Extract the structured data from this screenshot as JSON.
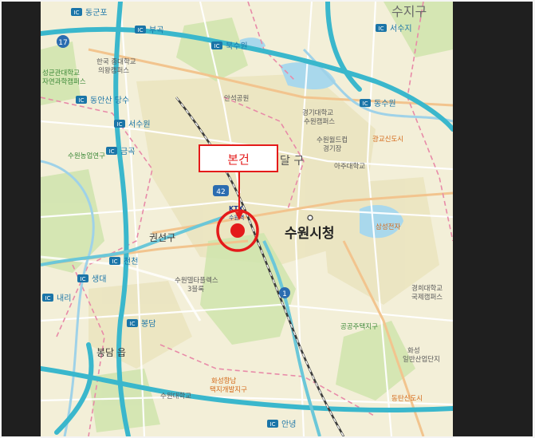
{
  "map": {
    "districts": {
      "suji": "수지구",
      "gwonseon": "권선구",
      "paldal": "달 구",
      "bongdam": "봉담 읍"
    },
    "city_hall": "수원시청",
    "callout": {
      "label": "본건"
    },
    "ic_badge": "IC",
    "interchanges": {
      "dongsuwon_top": "동군포",
      "bugok": "부곡",
      "buksuwon": "북수원",
      "seosuji": "서수지",
      "dongsuwon": "동수원",
      "dongansan": "동안산 당수",
      "seosuwon": "서수원",
      "geumgok": "금곡",
      "cheoncheon": "천천",
      "saengdae": "생대",
      "naeri": "내리",
      "bongdam": "봉담",
      "anyeong": "안녕"
    },
    "route_numbers": {
      "r17": "17",
      "r42": "42",
      "r1": "1",
      "r43": "43"
    },
    "places": {
      "hanguk": "한국 종대학교",
      "uiwang": "의왕캠퍼스",
      "seonggyun": "성균관대학교",
      "seonggyun2": "자연과학캠퍼스",
      "anseok": "안석공원",
      "gyeonggi": "경기대학교",
      "gyeonggi2": "수원캠퍼스",
      "suwon_world": "수원월드컵",
      "stadium": "경기장",
      "ajou": "아주대학교",
      "suwonsi_nonghyup": "수원농업연구",
      "gwanggyo": "광교신도시",
      "samsung": "삼성전자",
      "korail": "KTX",
      "suwon_station": "수원역",
      "suwon_datapark": "수원델타플렉스",
      "block3": "3블록",
      "suwon_univ": "수원대학교",
      "hwaseong": "화성향남",
      "hwaseong2": "택지개발지구",
      "gyunghee": "경희대학교",
      "gyunghee2": "국제캠퍼스",
      "dongtan": "동탄신도시",
      "hwaseong_ind": "화성",
      "hwaseong_ind2": "일반산업단지",
      "gonggong": "공공주택지구"
    }
  },
  "colors": {
    "frame_dark": "#1f1f1f",
    "map_bg": "#f3efd8",
    "expressway": "#3ab7cc",
    "rail": "#3c3c3c",
    "callout_red": "#e41a1a",
    "river": "#9fd2e8",
    "park": "#c9e2a8",
    "urban": "#ece6c4"
  }
}
